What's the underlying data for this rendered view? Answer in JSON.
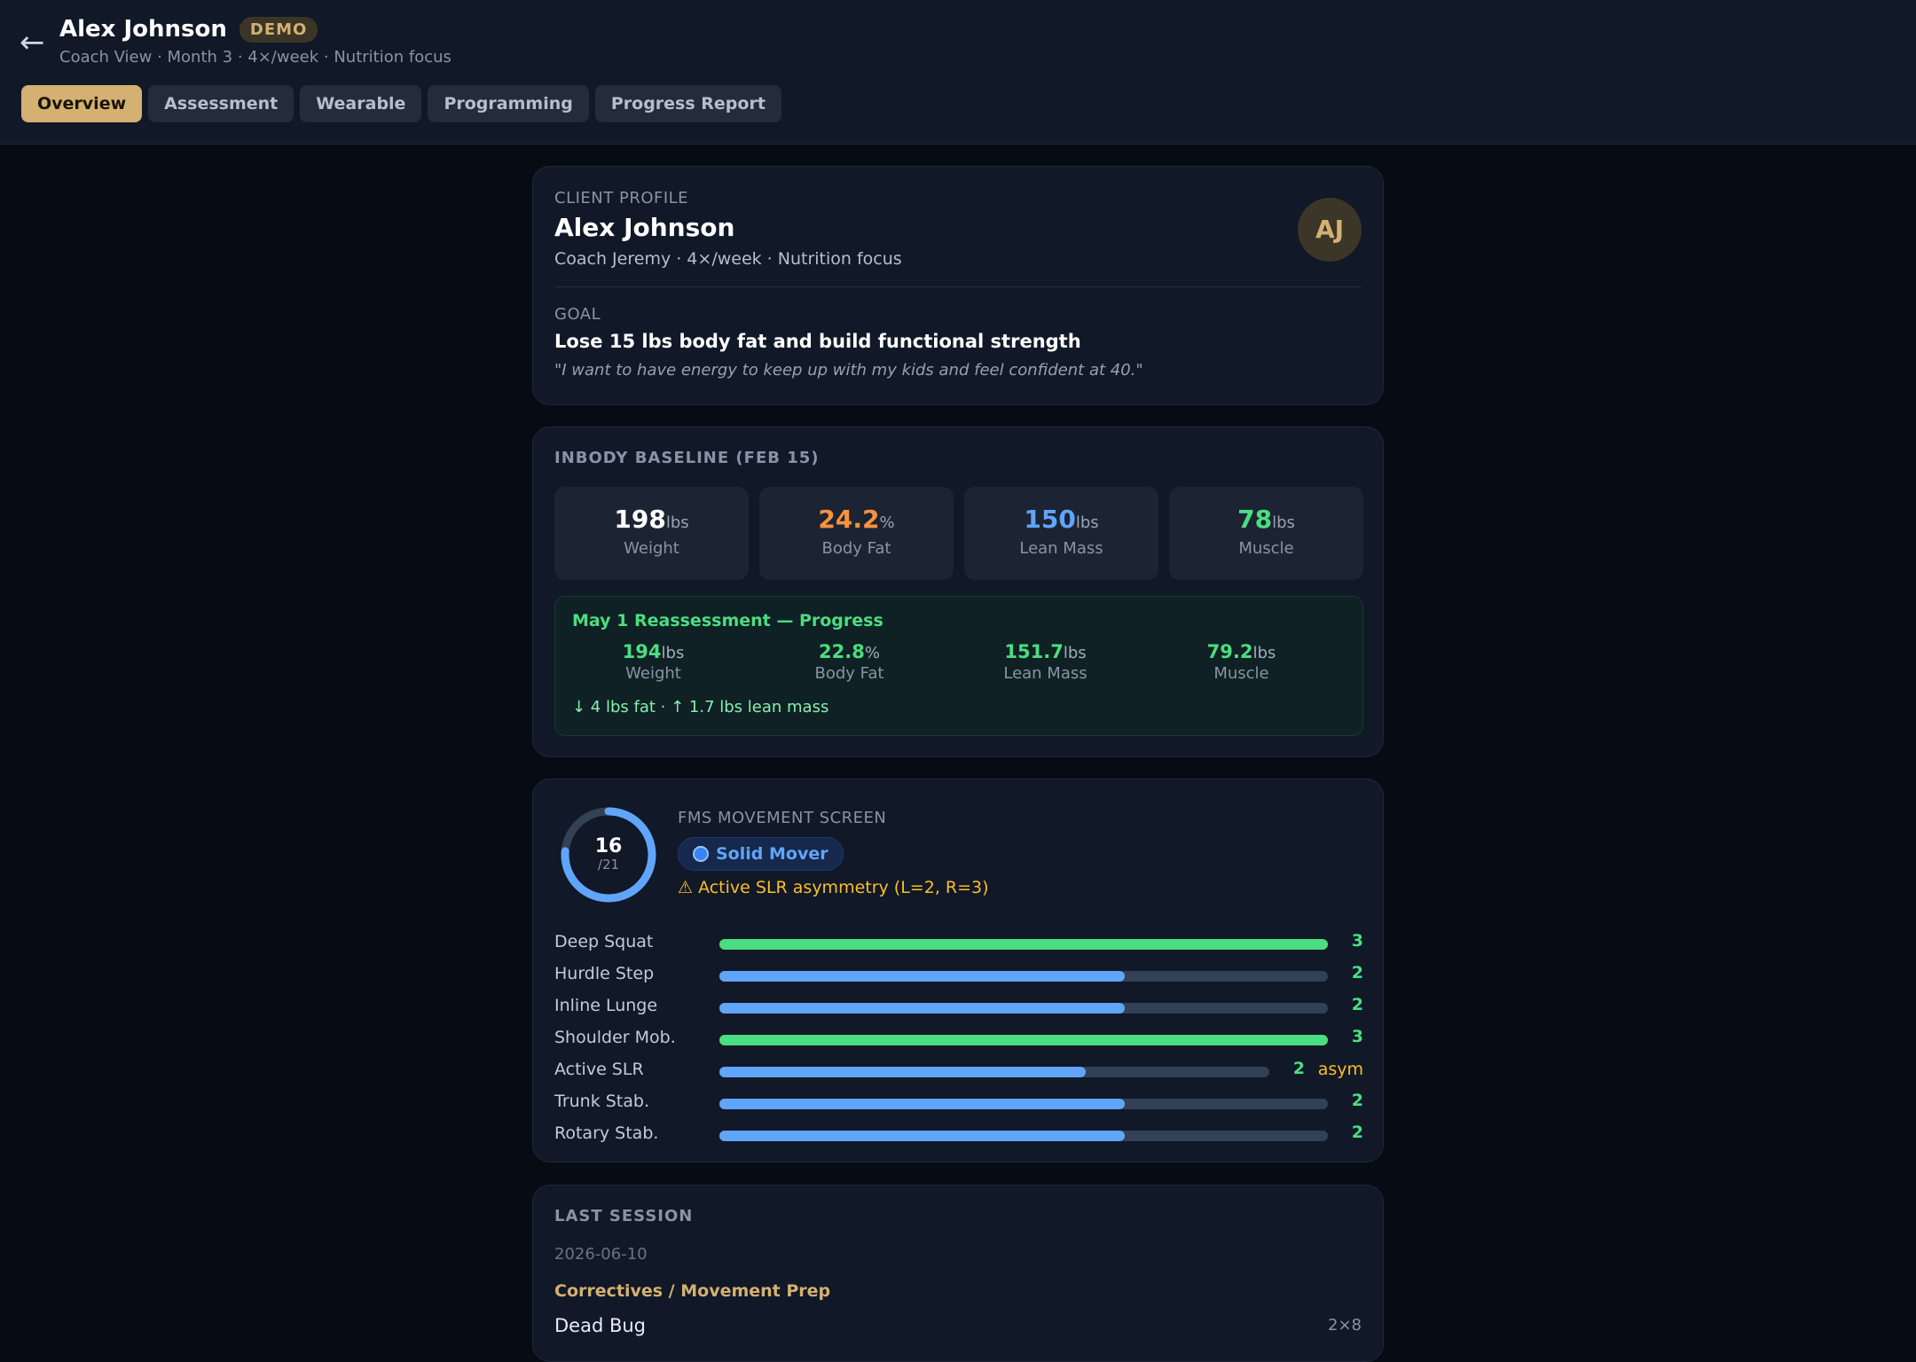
{
  "header": {
    "name": "Alex Johnson",
    "badge": "DEMO",
    "subtitle": "Coach View · Month 3 · 4×/week · Nutrition focus",
    "back_icon": "←",
    "tabs": [
      {
        "label": "Overview",
        "active": true
      },
      {
        "label": "Assessment",
        "active": false
      },
      {
        "label": "Wearable",
        "active": false
      },
      {
        "label": "Programming",
        "active": false
      },
      {
        "label": "Progress Report",
        "active": false
      }
    ]
  },
  "profile": {
    "section_label": "CLIENT PROFILE",
    "name": "Alex Johnson",
    "details": "Coach Jeremy · 4×/week · Nutrition focus",
    "initials": "AJ",
    "goal_label": "GOAL",
    "goal": "Lose 15 lbs body fat and build functional strength",
    "quote": "\"I want to have energy to keep up with my kids and feel confident at 40.\""
  },
  "inbody": {
    "title": "INBODY BASELINE (FEB 15)",
    "stats": [
      {
        "value": "198",
        "unit": "lbs",
        "label": "Weight",
        "color": "#ffffff"
      },
      {
        "value": "24.2",
        "unit": "%",
        "label": "Body Fat",
        "color": "#fb923c"
      },
      {
        "value": "150",
        "unit": "lbs",
        "label": "Lean Mass",
        "color": "#60a5fa"
      },
      {
        "value": "78",
        "unit": "lbs",
        "label": "Muscle",
        "color": "#4ade80"
      }
    ],
    "reassessment": {
      "title": "May 1 Reassessment — Progress",
      "stats": [
        {
          "value": "194",
          "unit": "lbs",
          "label": "Weight"
        },
        {
          "value": "22.8",
          "unit": "%",
          "label": "Body Fat"
        },
        {
          "value": "151.7",
          "unit": "lbs",
          "label": "Lean Mass"
        },
        {
          "value": "79.2",
          "unit": "lbs",
          "label": "Muscle"
        }
      ],
      "delta": "↓ 4 lbs fat · ↑ 1.7 lbs lean mass"
    }
  },
  "fms": {
    "label": "FMS MOVEMENT SCREEN",
    "score": "16",
    "total": "/21",
    "score_fraction": 0.762,
    "badge": "Solid Mover",
    "warning": "⚠ Active SLR asymmetry (L=2, R=3)",
    "movements": [
      {
        "name": "Deep Squat",
        "score": "3",
        "max": 3,
        "color": "#4ade80",
        "asym": ""
      },
      {
        "name": "Hurdle Step",
        "score": "2",
        "max": 3,
        "color": "#60a5fa",
        "asym": ""
      },
      {
        "name": "Inline Lunge",
        "score": "2",
        "max": 3,
        "color": "#60a5fa",
        "asym": ""
      },
      {
        "name": "Shoulder Mob.",
        "score": "3",
        "max": 3,
        "color": "#4ade80",
        "asym": ""
      },
      {
        "name": "Active SLR",
        "score": "2",
        "max": 3,
        "color": "#60a5fa",
        "asym": "asym"
      },
      {
        "name": "Trunk Stab.",
        "score": "2",
        "max": 3,
        "color": "#60a5fa",
        "asym": ""
      },
      {
        "name": "Rotary Stab.",
        "score": "2",
        "max": 3,
        "color": "#60a5fa",
        "asym": ""
      }
    ]
  },
  "last_session": {
    "title": "LAST SESSION",
    "date": "2026-06-10",
    "block": "Correctives / Movement Prep",
    "exercise": "Dead Bug",
    "sets": "2×8"
  }
}
